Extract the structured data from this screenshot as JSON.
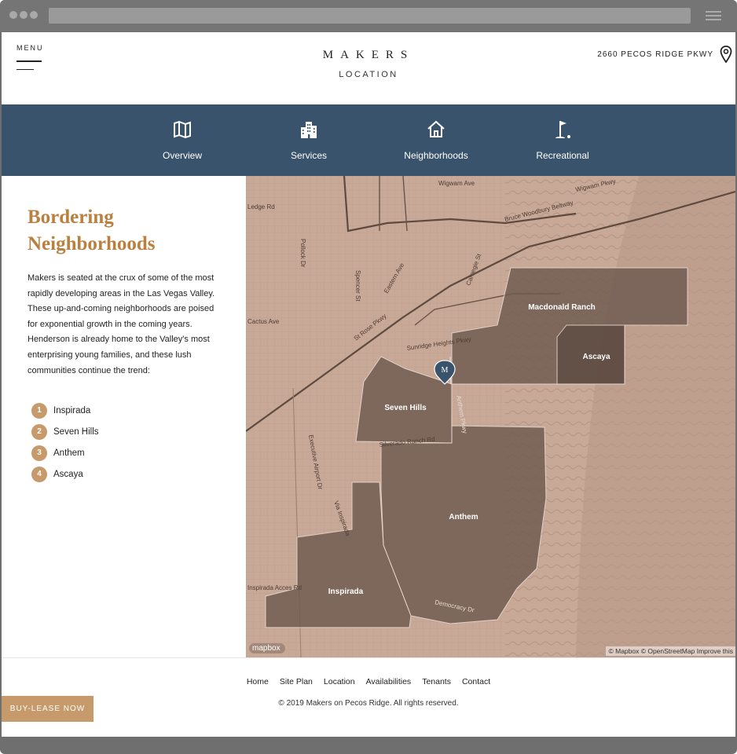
{
  "header": {
    "menu_label": "MENU",
    "logo": "MAKERS",
    "subtitle": "LOCATION",
    "address": "2660 PECOS RIDGE PKWY"
  },
  "nav": {
    "items": [
      {
        "label": "Overview",
        "icon": "map-icon"
      },
      {
        "label": "Services",
        "icon": "building-icon"
      },
      {
        "label": "Neighborhoods",
        "icon": "home-icon"
      },
      {
        "label": "Recreational",
        "icon": "golf-flag-icon"
      }
    ]
  },
  "content": {
    "heading": "Bordering Neighborhoods",
    "paragraph": "Makers is seated at the crux of some of the most rapidly developing areas in the Las Vegas Valley. These up-and-coming neighborhoods are poised for exponential growth in the coming years. Henderson is already home to the Valley's most enterprising young families, and these lush communities continue the trend:",
    "list": [
      {
        "num": "1",
        "label": "Inspirada"
      },
      {
        "num": "2",
        "label": "Seven Hills"
      },
      {
        "num": "3",
        "label": "Anthem"
      },
      {
        "num": "4",
        "label": "Ascaya"
      }
    ]
  },
  "map": {
    "marker": "M",
    "regions": [
      "Macdonald Ranch",
      "Ascaya",
      "Seven Hills",
      "Anthem",
      "Inspirada"
    ],
    "streets": [
      "Wigwam Ave",
      "Wigwam Pkwy",
      "Bruce Woodbury Beltway",
      "Pollock Dr",
      "Spencer St",
      "Eastern Ave",
      "Carnegie St",
      "Sunridge Heights Pkwy",
      "St Rose Pkwy",
      "Executive Airport Dr",
      "Via Inspirada",
      "Anthem Pkwy",
      "Democracy Dr",
      "Inspirada Acces Rd",
      "Cactus Ave",
      "Ledge Rd",
      "Silverado Ranch Rd"
    ],
    "mapbox_label": "mapbox",
    "attribution": "© Mapbox © OpenStreetMap Improve this"
  },
  "footer": {
    "links": [
      "Home",
      "Site Plan",
      "Location",
      "Availabilities",
      "Tenants",
      "Contact"
    ],
    "copyright": "© 2019 Makers on Pecos Ridge. All rights reserved.",
    "buy_button": "BUY-LEASE NOW"
  },
  "colors": {
    "nav_bg": "#3a536c",
    "accent": "#b9803f",
    "badge": "#c69a6a",
    "map_base": "#c8a897",
    "region_fill": "#6e5a50"
  }
}
